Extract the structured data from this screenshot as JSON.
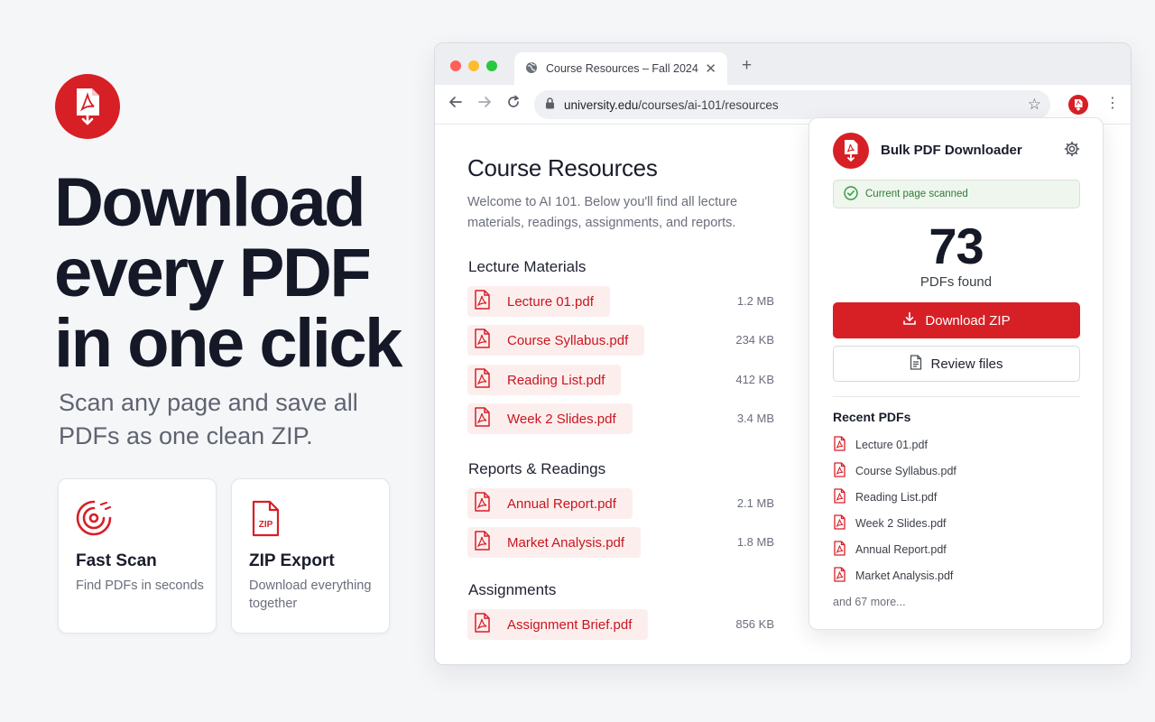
{
  "hero": {
    "title_lines": [
      "Download",
      "every PDF",
      "in one click"
    ],
    "subtitle": "Scan any page and save all PDFs as one clean ZIP.",
    "features": [
      {
        "title": "Fast Scan",
        "desc": "Find PDFs in seconds",
        "icon": "scan-target-icon"
      },
      {
        "title": "ZIP Export",
        "desc": "Download everything together",
        "icon": "zip-file-icon"
      }
    ]
  },
  "browser": {
    "tab_title": "Course Resources – Fall 2024",
    "url_host": "university.edu",
    "url_path": "/courses/ai-101/resources",
    "colors": {
      "close": "#ff5f57",
      "minimize": "#febc2e",
      "maximize": "#28c840"
    }
  },
  "page": {
    "title": "Course Resources",
    "intro": "Welcome to AI 101. Below you'll find all lecture materials, readings, assignments, and reports.",
    "sections": [
      {
        "heading": "Lecture Materials",
        "files": [
          {
            "name": "Lecture 01.pdf",
            "size": "1.2 MB"
          },
          {
            "name": "Course Syllabus.pdf",
            "size": "234 KB"
          },
          {
            "name": "Reading List.pdf",
            "size": "412 KB"
          },
          {
            "name": "Week 2 Slides.pdf",
            "size": "3.4 MB"
          }
        ]
      },
      {
        "heading": "Reports & Readings",
        "files": [
          {
            "name": "Annual Report.pdf",
            "size": "2.1 MB"
          },
          {
            "name": "Market Analysis.pdf",
            "size": "1.8 MB"
          }
        ]
      },
      {
        "heading": "Assignments",
        "files": [
          {
            "name": "Assignment Brief.pdf",
            "size": "856 KB"
          }
        ]
      }
    ]
  },
  "popup": {
    "title": "Bulk PDF Downloader",
    "status": "Current page scanned",
    "count": "73",
    "count_label": "PDFs found",
    "primary_button": "Download ZIP",
    "secondary_button": "Review files",
    "recent_heading": "Recent PDFs",
    "recent": [
      "Lecture 01.pdf",
      "Course Syllabus.pdf",
      "Reading List.pdf",
      "Week 2 Slides.pdf",
      "Annual Report.pdf",
      "Market Analysis.pdf"
    ],
    "more": "and 67 more..."
  },
  "colors": {
    "brand": "#d71f26",
    "pill_bg": "#fdeeee",
    "success": "#2f7d32"
  }
}
